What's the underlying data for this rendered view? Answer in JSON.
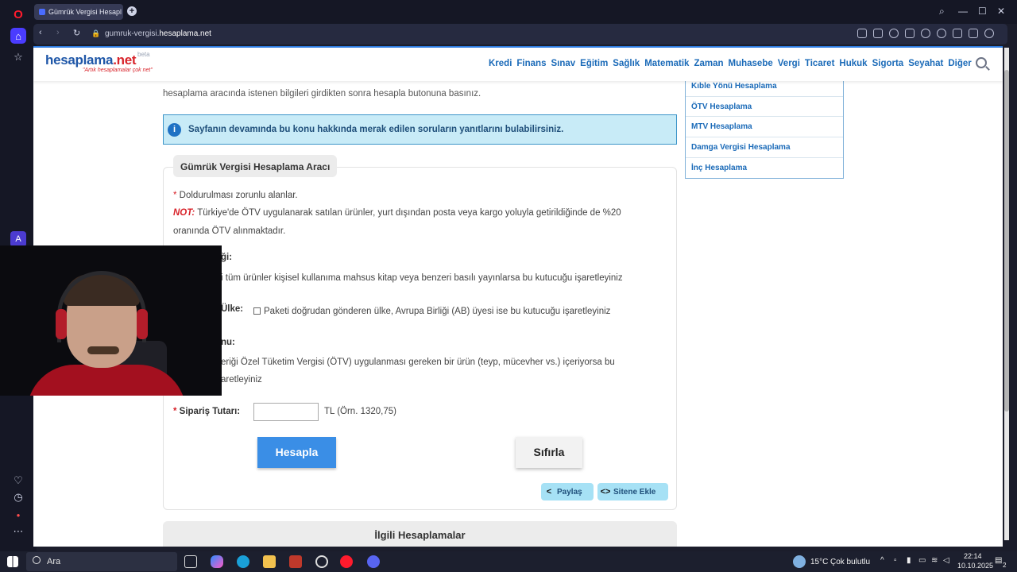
{
  "browser": {
    "tab_title": "Gümrük Vergisi Hesaplama",
    "url_prefix": "gumruk-vergisi.",
    "url_domain": "hesaplama.net"
  },
  "site": {
    "logo_main": "hesaplama",
    "logo_tld": ".net",
    "logo_beta": "beta",
    "slogan": "\"Artık hesaplamalar çok net\"",
    "nav": [
      "Kredi",
      "Finans",
      "Sınav",
      "Eğitim",
      "Sağlık",
      "Matematik",
      "Zaman",
      "Muhasebe",
      "Vergi",
      "Ticaret",
      "Hukuk",
      "Sigorta",
      "Seyahat",
      "Diğer"
    ]
  },
  "intro": {
    "line2": "hesaplama aracında istenen bilgileri girdikten sonra hesapla butonuna basınız."
  },
  "info_box": {
    "text": "Sayfanın devamında bu konu hakkında merak edilen soruların yanıtlarını bulabilirsiniz."
  },
  "side_links": [
    "Kıble Yönü Hesaplama",
    "ÖTV Hesaplama",
    "MTV Hesaplama",
    "Damga Vergisi Hesaplama",
    "İnç Hesaplama"
  ],
  "calculator": {
    "title": "Gümrük Vergisi Hesaplama Aracı",
    "required_note": "Doldurulması zorunlu alanlar.",
    "note_label": "NOT:",
    "note_line1": "Türkiye'de ÖTV uygulanarak satılan ürünler, yurt dışından posta veya kargo yoluyla getirildiğinde de %20",
    "note_line2": "oranında ÖTV alınmaktadır.",
    "field1_label_partial": "ği:",
    "field1_text_partial": "i tüm ürünler kişisel kullanıma mahsus kitap veya benzeri basılı yayınlarsa bu kutucuğu işaretleyiniz",
    "field2_label_partial": "Ülke:",
    "field2_text": "Paketi doğrudan gönderen ülke, Avrupa Birliği (AB) üyesi ise bu kutucuğu işaretleyiniz",
    "field3_label_partial": "nu:",
    "field3_text_line1": "eriği Özel Tüketim Vergisi (ÖTV) uygulanması gereken bir ürün (teyp, mücevher vs.) içeriyorsa bu",
    "field3_text_line2": "aretleyiniz",
    "amount_label": "Sipariş Tutarı:",
    "amount_value": "",
    "amount_hint": "TL (Örn. 1320,75)",
    "calc_button": "Hesapla",
    "reset_button": "Sıfırla",
    "share_button": "Paylaş",
    "embed_button": "Sitene Ekle"
  },
  "related": {
    "title": "İlgili Hesaplamalar"
  },
  "taskbar": {
    "search_label": "Ara",
    "weather_temp": "15°C",
    "weather_text": "Çok bulutlu",
    "time": "22:14",
    "date": "10.10.2025",
    "notif_count": "2"
  }
}
